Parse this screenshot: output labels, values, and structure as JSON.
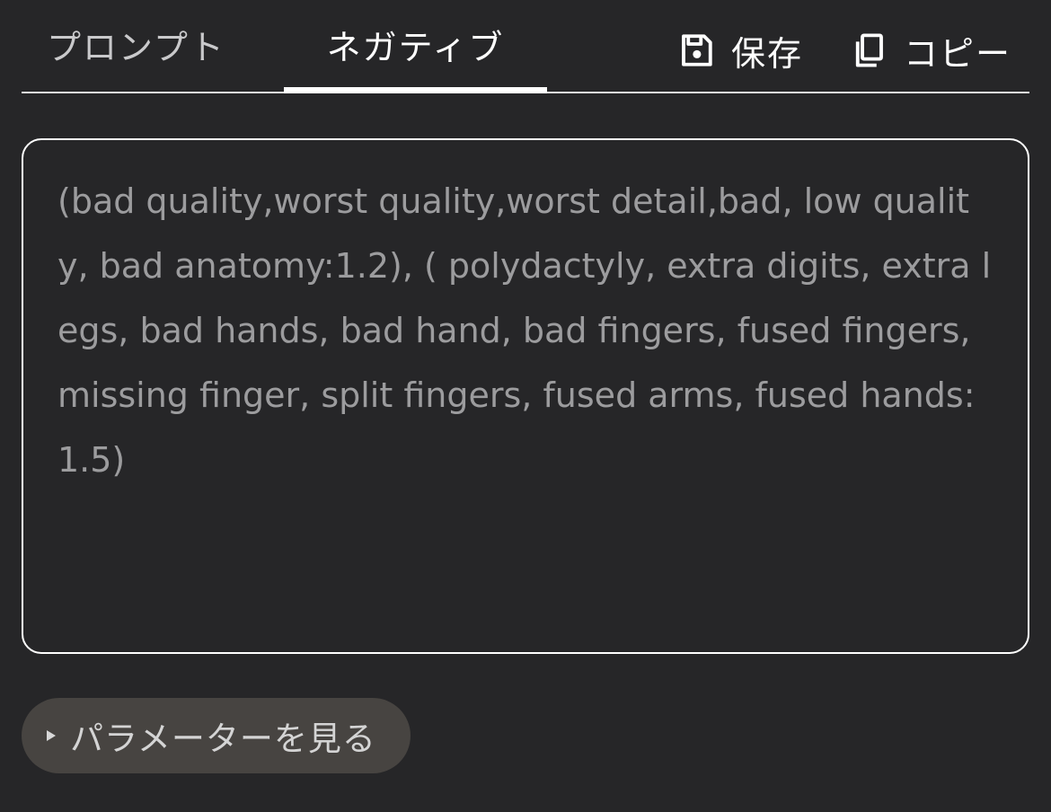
{
  "tabs": {
    "prompt_label": "プロンプト",
    "negative_label": "ネガティブ",
    "active": "negative"
  },
  "actions": {
    "save_label": "保存",
    "copy_label": "コピー",
    "save_icon": "floppy-disk-icon",
    "copy_icon": "copy-icon"
  },
  "editor": {
    "value": "(bad quality,worst quality,worst detail,bad, low quality, bad anatomy:1.2), ( polydactyly, extra digits, extra legs, bad hands, bad hand, bad fingers, fused fingers, missing finger, split fingers, fused arms, fused hands:1.5)"
  },
  "params": {
    "label": "パラメーターを見る",
    "expand_icon": "triangle-right-icon"
  },
  "colors": {
    "background": "#262628",
    "text_primary": "#ffffff",
    "text_muted": "#9c9c9e",
    "pill_bg": "#474441"
  }
}
